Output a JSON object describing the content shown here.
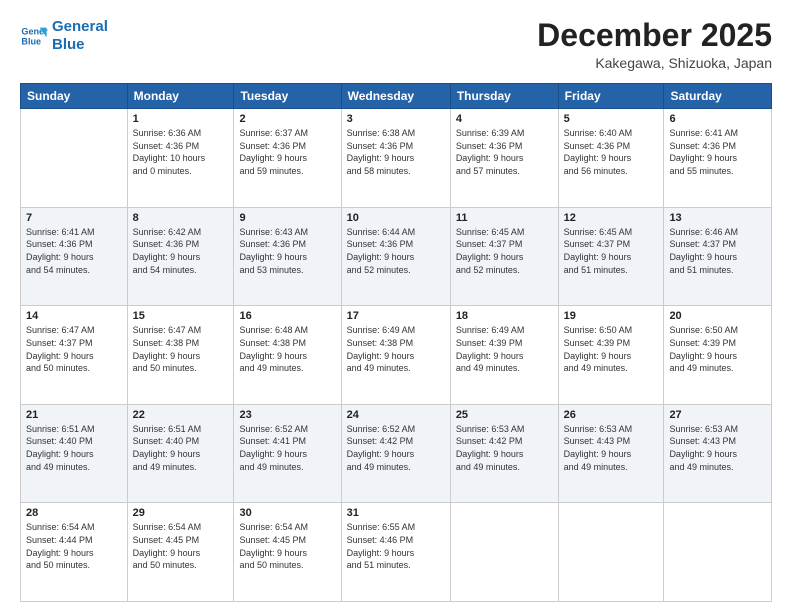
{
  "header": {
    "logo_line1": "General",
    "logo_line2": "Blue",
    "month_title": "December 2025",
    "subtitle": "Kakegawa, Shizuoka, Japan"
  },
  "days_of_week": [
    "Sunday",
    "Monday",
    "Tuesday",
    "Wednesday",
    "Thursday",
    "Friday",
    "Saturday"
  ],
  "weeks": [
    [
      {
        "day": "",
        "info": ""
      },
      {
        "day": "1",
        "info": "Sunrise: 6:36 AM\nSunset: 4:36 PM\nDaylight: 10 hours\nand 0 minutes."
      },
      {
        "day": "2",
        "info": "Sunrise: 6:37 AM\nSunset: 4:36 PM\nDaylight: 9 hours\nand 59 minutes."
      },
      {
        "day": "3",
        "info": "Sunrise: 6:38 AM\nSunset: 4:36 PM\nDaylight: 9 hours\nand 58 minutes."
      },
      {
        "day": "4",
        "info": "Sunrise: 6:39 AM\nSunset: 4:36 PM\nDaylight: 9 hours\nand 57 minutes."
      },
      {
        "day": "5",
        "info": "Sunrise: 6:40 AM\nSunset: 4:36 PM\nDaylight: 9 hours\nand 56 minutes."
      },
      {
        "day": "6",
        "info": "Sunrise: 6:41 AM\nSunset: 4:36 PM\nDaylight: 9 hours\nand 55 minutes."
      }
    ],
    [
      {
        "day": "7",
        "info": "Sunrise: 6:41 AM\nSunset: 4:36 PM\nDaylight: 9 hours\nand 54 minutes."
      },
      {
        "day": "8",
        "info": "Sunrise: 6:42 AM\nSunset: 4:36 PM\nDaylight: 9 hours\nand 54 minutes."
      },
      {
        "day": "9",
        "info": "Sunrise: 6:43 AM\nSunset: 4:36 PM\nDaylight: 9 hours\nand 53 minutes."
      },
      {
        "day": "10",
        "info": "Sunrise: 6:44 AM\nSunset: 4:36 PM\nDaylight: 9 hours\nand 52 minutes."
      },
      {
        "day": "11",
        "info": "Sunrise: 6:45 AM\nSunset: 4:37 PM\nDaylight: 9 hours\nand 52 minutes."
      },
      {
        "day": "12",
        "info": "Sunrise: 6:45 AM\nSunset: 4:37 PM\nDaylight: 9 hours\nand 51 minutes."
      },
      {
        "day": "13",
        "info": "Sunrise: 6:46 AM\nSunset: 4:37 PM\nDaylight: 9 hours\nand 51 minutes."
      }
    ],
    [
      {
        "day": "14",
        "info": "Sunrise: 6:47 AM\nSunset: 4:37 PM\nDaylight: 9 hours\nand 50 minutes."
      },
      {
        "day": "15",
        "info": "Sunrise: 6:47 AM\nSunset: 4:38 PM\nDaylight: 9 hours\nand 50 minutes."
      },
      {
        "day": "16",
        "info": "Sunrise: 6:48 AM\nSunset: 4:38 PM\nDaylight: 9 hours\nand 49 minutes."
      },
      {
        "day": "17",
        "info": "Sunrise: 6:49 AM\nSunset: 4:38 PM\nDaylight: 9 hours\nand 49 minutes."
      },
      {
        "day": "18",
        "info": "Sunrise: 6:49 AM\nSunset: 4:39 PM\nDaylight: 9 hours\nand 49 minutes."
      },
      {
        "day": "19",
        "info": "Sunrise: 6:50 AM\nSunset: 4:39 PM\nDaylight: 9 hours\nand 49 minutes."
      },
      {
        "day": "20",
        "info": "Sunrise: 6:50 AM\nSunset: 4:39 PM\nDaylight: 9 hours\nand 49 minutes."
      }
    ],
    [
      {
        "day": "21",
        "info": "Sunrise: 6:51 AM\nSunset: 4:40 PM\nDaylight: 9 hours\nand 49 minutes."
      },
      {
        "day": "22",
        "info": "Sunrise: 6:51 AM\nSunset: 4:40 PM\nDaylight: 9 hours\nand 49 minutes."
      },
      {
        "day": "23",
        "info": "Sunrise: 6:52 AM\nSunset: 4:41 PM\nDaylight: 9 hours\nand 49 minutes."
      },
      {
        "day": "24",
        "info": "Sunrise: 6:52 AM\nSunset: 4:42 PM\nDaylight: 9 hours\nand 49 minutes."
      },
      {
        "day": "25",
        "info": "Sunrise: 6:53 AM\nSunset: 4:42 PM\nDaylight: 9 hours\nand 49 minutes."
      },
      {
        "day": "26",
        "info": "Sunrise: 6:53 AM\nSunset: 4:43 PM\nDaylight: 9 hours\nand 49 minutes."
      },
      {
        "day": "27",
        "info": "Sunrise: 6:53 AM\nSunset: 4:43 PM\nDaylight: 9 hours\nand 49 minutes."
      }
    ],
    [
      {
        "day": "28",
        "info": "Sunrise: 6:54 AM\nSunset: 4:44 PM\nDaylight: 9 hours\nand 50 minutes."
      },
      {
        "day": "29",
        "info": "Sunrise: 6:54 AM\nSunset: 4:45 PM\nDaylight: 9 hours\nand 50 minutes."
      },
      {
        "day": "30",
        "info": "Sunrise: 6:54 AM\nSunset: 4:45 PM\nDaylight: 9 hours\nand 50 minutes."
      },
      {
        "day": "31",
        "info": "Sunrise: 6:55 AM\nSunset: 4:46 PM\nDaylight: 9 hours\nand 51 minutes."
      },
      {
        "day": "",
        "info": ""
      },
      {
        "day": "",
        "info": ""
      },
      {
        "day": "",
        "info": ""
      }
    ]
  ]
}
